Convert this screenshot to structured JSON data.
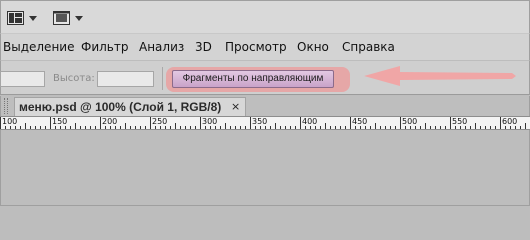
{
  "menubar": {
    "items": [
      "Выделение",
      "Фильтр",
      "Анализ",
      "3D",
      "Просмотр",
      "Окно",
      "Справка"
    ]
  },
  "options_bar": {
    "height_label": "Высота:",
    "slice_button_label": "Фрагменты по направляющим"
  },
  "document_tab": {
    "title": "меню.psd @ 100% (Слой 1, RGB/8)",
    "close_glyph": "×"
  },
  "ruler": {
    "labels": [
      "100",
      "150",
      "200",
      "250",
      "300",
      "350",
      "400",
      "450",
      "500",
      "550",
      "600"
    ]
  },
  "colors": {
    "highlight": "#e6a7a7",
    "arrow": "#f0a6a6",
    "slice_button": "#d4b2d4"
  },
  "icons": [
    "arrange-documents-icon",
    "screen-mode-icon",
    "dropdown-arrow-icon",
    "close-icon"
  ]
}
